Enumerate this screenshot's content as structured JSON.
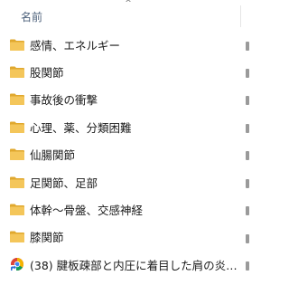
{
  "header": {
    "name_column": "名前"
  },
  "items": [
    {
      "label": "感情、エネルギー",
      "icon": "folder-icon"
    },
    {
      "label": "股関節",
      "icon": "folder-icon"
    },
    {
      "label": "事故後の衝撃",
      "icon": "folder-icon"
    },
    {
      "label": "心理、薬、分類困難",
      "icon": "folder-icon"
    },
    {
      "label": "仙腸関節",
      "icon": "folder-icon"
    },
    {
      "label": "足関節、足部",
      "icon": "folder-icon"
    },
    {
      "label": "体幹～骨盤、交感神経",
      "icon": "folder-icon"
    },
    {
      "label": "膝関節",
      "icon": "folder-icon"
    },
    {
      "label": "(38) 腱板疎部と内圧に着目した肩の炎症と...",
      "icon": "chrome-shortcut-icon"
    }
  ],
  "colors": {
    "folder_body": "#f2c14e",
    "folder_tab": "#e0a82e",
    "header_text": "#4c607a"
  }
}
